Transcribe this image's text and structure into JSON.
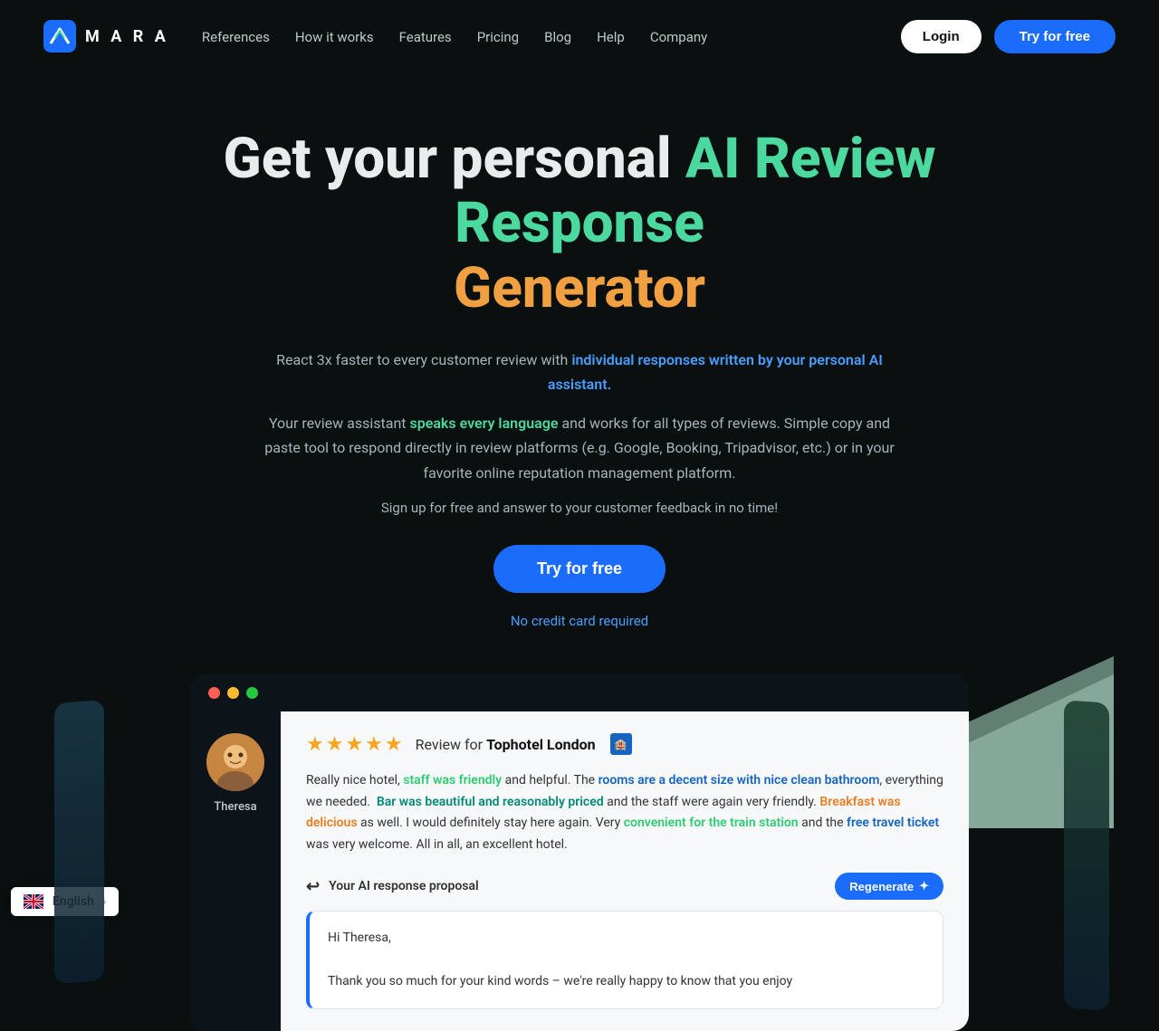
{
  "nav": {
    "logo_text": "M A R A",
    "links": [
      {
        "label": "References",
        "id": "references"
      },
      {
        "label": "How it works",
        "id": "how-it-works"
      },
      {
        "label": "Features",
        "id": "features"
      },
      {
        "label": "Pricing",
        "id": "pricing"
      },
      {
        "label": "Blog",
        "id": "blog"
      },
      {
        "label": "Help",
        "id": "help"
      },
      {
        "label": "Company",
        "id": "company"
      }
    ],
    "login_label": "Login",
    "try_label": "Try for free"
  },
  "hero": {
    "heading_part1": "Get your personal ",
    "heading_ai": "AI Review Response",
    "heading_part2": " ",
    "heading_generator": "Generator",
    "desc1": "React 3x faster to every customer review with ",
    "desc1_highlight": "individual responses written by your personal AI assistant.",
    "desc2": "Your review assistant ",
    "desc2_highlight": "speaks every language",
    "desc2_end": " and works for all types of reviews. Simple copy and paste tool to respond directly in review platforms (e.g. Google, Booking, Tripadvisor, etc.) or in your favorite online reputation management platform.",
    "signup_text": "Sign up for free and answer to your customer feedback in no time!",
    "cta_label": "Try for free",
    "no_credit": "No credit card required"
  },
  "demo": {
    "titlebar": {
      "dot_red": "red",
      "dot_yellow": "yellow",
      "dot_green": "green"
    },
    "reviewer_name": "Theresa",
    "stars": "★★★★★",
    "review_for_prefix": "Review for ",
    "hotel_name": "Tophotel London",
    "review_text_parts": [
      {
        "text": "Really nice hotel, ",
        "highlight": false
      },
      {
        "text": "staff was friendly",
        "highlight": "green"
      },
      {
        "text": " and helpful. The ",
        "highlight": false
      },
      {
        "text": "rooms are a decent size with nice clean bathroom",
        "highlight": "blue"
      },
      {
        "text": ", everything we needed.  ",
        "highlight": false
      },
      {
        "text": "Bar was beautiful and reasonably priced",
        "highlight": "teal"
      },
      {
        "text": " and the staff were again very friendly. ",
        "highlight": false
      },
      {
        "text": "Breakfast was delicious",
        "highlight": "orange"
      },
      {
        "text": " as well. I would definitely stay here again. Very ",
        "highlight": false
      },
      {
        "text": "convenient for the train station",
        "highlight": "green"
      },
      {
        "text": " and the ",
        "highlight": false
      },
      {
        "text": "free travel ticket",
        "highlight": "blue"
      },
      {
        "text": " was very welcome. All in all, an excellent hotel.",
        "highlight": false
      }
    ],
    "ai_response_label": "Your AI response proposal",
    "regenerate_label": "Regenerate",
    "ai_response_text": "Hi Theresa,\n\nThank you so much for your kind words – we're really happy to know that you enjoy"
  },
  "footer": {
    "language": "English"
  }
}
